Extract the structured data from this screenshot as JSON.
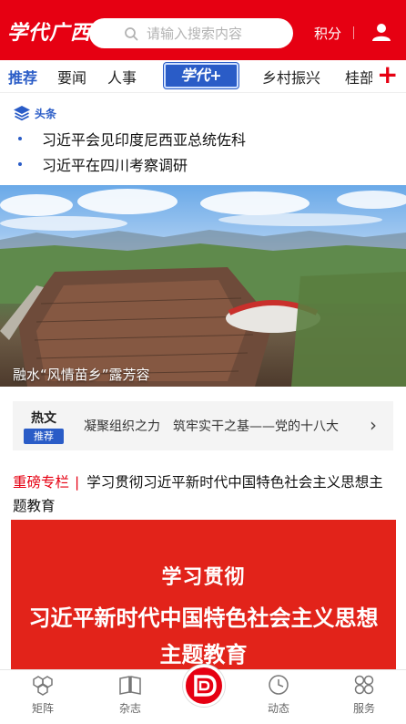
{
  "header": {
    "logo": "学代广西",
    "search_placeholder": "请输入搜索内容",
    "points_label": "积分"
  },
  "tabs": {
    "items": [
      {
        "label": "推荐",
        "active": true
      },
      {
        "label": "要闻"
      },
      {
        "label": "人事"
      },
      {
        "label": "学代+",
        "special": true
      },
      {
        "label": "乡村振兴"
      },
      {
        "label": "桂部"
      }
    ],
    "add_label": "+"
  },
  "headlines": {
    "section_label": "头条",
    "items": [
      "习近平会见印度尼西亚总统佐科",
      "习近平在四川考察调研"
    ]
  },
  "hero": {
    "caption": "融水“风情苗乡”露芳容"
  },
  "hot": {
    "badge_top": "热文",
    "badge_bottom": "推荐",
    "text": "凝聚组织之力　筑牢实干之基——党的十八大"
  },
  "feature": {
    "tag": "重磅专栏",
    "separator": "|",
    "title": "学习贯彻习近平新时代中国特色社会主义思想主题教育"
  },
  "banner": {
    "line1": "学习贯彻",
    "line2": "习近平新时代中国特色社会主义思想",
    "line3": "主题教育"
  },
  "bottom_nav": [
    {
      "label": "矩阵",
      "icon": "matrix-icon"
    },
    {
      "label": "杂志",
      "icon": "magazine-icon"
    },
    {
      "label": "",
      "icon": "home-logo-icon"
    },
    {
      "label": "动态",
      "icon": "clock-icon"
    },
    {
      "label": "服务",
      "icon": "grid-icon"
    }
  ],
  "colors": {
    "brand_red": "#e60012",
    "accent_blue": "#2a5cc7"
  }
}
